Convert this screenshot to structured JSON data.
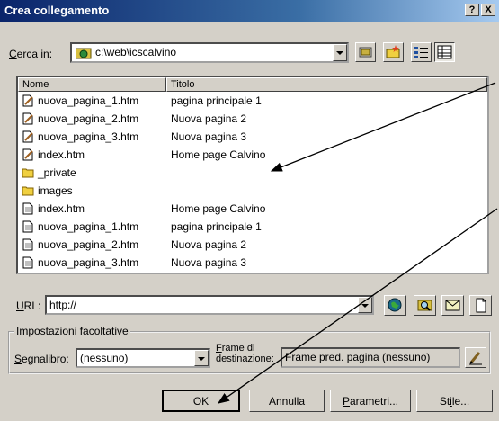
{
  "window": {
    "title": "Crea collegamento",
    "help_label": "?",
    "close_label": "X"
  },
  "lookin": {
    "label_pre": "C",
    "label_rest": "erca in:",
    "value": "c:\\web\\icscalvino"
  },
  "columns": {
    "name": "Nome",
    "title": "Titolo"
  },
  "files": [
    {
      "name": "nuova_pagina_1.htm",
      "title": "pagina principale 1",
      "icon": "edit-page-icon"
    },
    {
      "name": "nuova_pagina_2.htm",
      "title": "Nuova pagina 2",
      "icon": "edit-page-icon"
    },
    {
      "name": "nuova_pagina_3.htm",
      "title": "Nuova pagina 3",
      "icon": "edit-page-icon"
    },
    {
      "name": "index.htm",
      "title": "Home page Calvino",
      "icon": "edit-page-icon"
    },
    {
      "name": "_private",
      "title": "",
      "icon": "folder-icon"
    },
    {
      "name": "images",
      "title": "",
      "icon": "folder-icon"
    },
    {
      "name": "index.htm",
      "title": "Home page Calvino",
      "icon": "page-icon"
    },
    {
      "name": "nuova_pagina_1.htm",
      "title": "pagina principale 1",
      "icon": "page-icon"
    },
    {
      "name": "nuova_pagina_2.htm",
      "title": "Nuova pagina 2",
      "icon": "page-icon"
    },
    {
      "name": "nuova_pagina_3.htm",
      "title": "Nuova pagina 3",
      "icon": "page-icon"
    }
  ],
  "url": {
    "label_pre": "U",
    "label_rest": "RL:",
    "value": "http://"
  },
  "optional": {
    "legend": "Impostazioni facoltative",
    "bookmark_label_pre": "S",
    "bookmark_label_rest": "egnalibro:",
    "bookmark_value": "(nessuno)",
    "frame_label_line1_pre": "F",
    "frame_label_line1_rest": "rame di",
    "frame_label_line2": "destinazione:",
    "frame_value": "Frame pred. pagina (nessuno)"
  },
  "buttons": {
    "ok": "OK",
    "cancel": "Annulla",
    "params_pre": "P",
    "params_rest": "arametri...",
    "style_pre": "St",
    "style_u": "i",
    "style_rest": "le..."
  },
  "colors": {
    "title_start": "#0a246a",
    "title_end": "#a6caf0",
    "face": "#d4d0c8"
  }
}
